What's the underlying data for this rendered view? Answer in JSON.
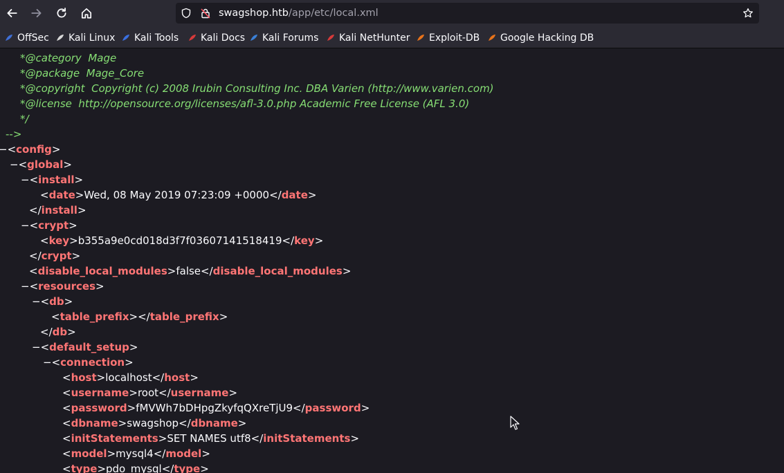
{
  "browser": {
    "url_host": "swagshop.htb",
    "url_path": "/app/etc/local.xml",
    "icons": [
      "back-arrow-icon",
      "forward-arrow-icon",
      "reload-icon",
      "home-icon",
      "shield-icon",
      "insecure-lock-icon",
      "star-icon"
    ]
  },
  "bookmarks": [
    {
      "label": "OffSec",
      "icon": "offsec-icon",
      "color": "#3f6fd6"
    },
    {
      "label": "Kali Linux",
      "icon": "kali-dragon-icon",
      "color": "#d8d8d8"
    },
    {
      "label": "Kali Tools",
      "icon": "kali-tools-icon",
      "color": "#3a6fe0"
    },
    {
      "label": "Kali Docs",
      "icon": "kali-docs-icon",
      "color": "#d63a3a"
    },
    {
      "label": "Kali Forums",
      "icon": "kali-forums-icon",
      "color": "#3a7fd6"
    },
    {
      "label": "Kali NetHunter",
      "icon": "nethunter-icon",
      "color": "#d63a3a"
    },
    {
      "label": "Exploit-DB",
      "icon": "exploit-db-icon",
      "color": "#e8731a"
    },
    {
      "label": "Google Hacking DB",
      "icon": "ghdb-icon",
      "color": "#e8731a"
    }
  ],
  "xml": {
    "comment_lines": [
      {
        "star": "*",
        "tag": "@category",
        "text": "Mage"
      },
      {
        "star": "*",
        "tag": "@package",
        "text": "Mage_Core"
      },
      {
        "star": "*",
        "tag": "@copyright",
        "text": "Copyright (c) 2008 Irubin Consulting Inc. DBA Varien (http://www.varien.com)"
      },
      {
        "star": "*",
        "tag": "@license",
        "text": "http://opensource.org/licenses/afl-3.0.php Academic Free License (AFL 3.0)"
      },
      {
        "star": "*/",
        "tag": "",
        "text": ""
      }
    ],
    "comment_close": "-->",
    "toggle_symbol": "−",
    "nodes": [
      {
        "toggle": true,
        "open": "config"
      },
      {
        "toggle": true,
        "open": "global"
      },
      {
        "toggle": true,
        "open": "install"
      },
      {
        "element": "date",
        "value": "Wed, 08 May 2019 07:23:09 +0000"
      },
      {
        "close": "install"
      },
      {
        "toggle": true,
        "open": "crypt"
      },
      {
        "element": "key",
        "value": "b355a9e0cd018d3f7f03607141518419"
      },
      {
        "close": "crypt"
      },
      {
        "element": "disable_local_modules",
        "value": "false"
      },
      {
        "toggle": true,
        "open": "resources"
      },
      {
        "toggle": true,
        "open": "db"
      },
      {
        "element": "table_prefix",
        "value": ""
      },
      {
        "close": "db"
      },
      {
        "toggle": true,
        "open": "default_setup"
      },
      {
        "toggle": true,
        "open": "connection"
      },
      {
        "element": "host",
        "value": "localhost"
      },
      {
        "element": "username",
        "value": "root"
      },
      {
        "element": "password",
        "value": "fMVWh7bDHpgZkyfqQXreTjU9"
      },
      {
        "element": "dbname",
        "value": "swagshop"
      },
      {
        "element": "initStatements",
        "value": "SET NAMES utf8"
      },
      {
        "element": "model",
        "value": "mysql4"
      },
      {
        "element": "type",
        "value": "pdo_mysql"
      }
    ]
  }
}
